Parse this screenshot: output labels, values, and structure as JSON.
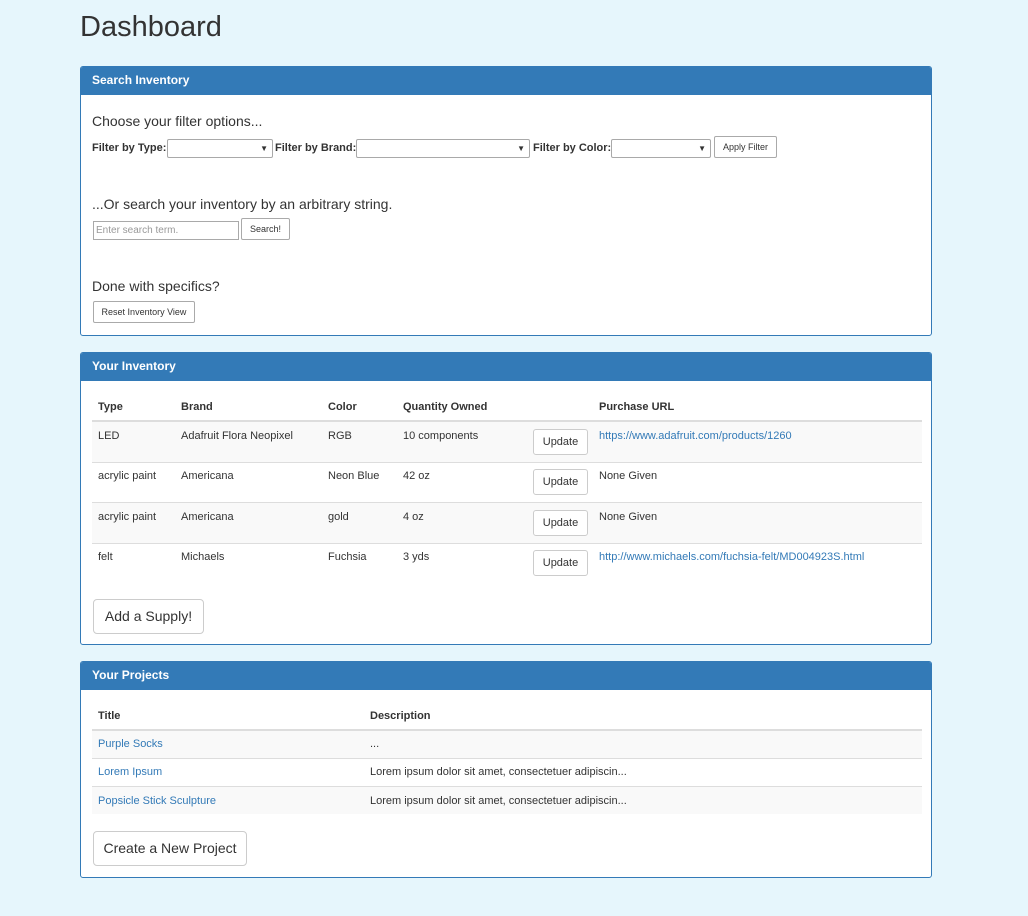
{
  "page_title": "Dashboard",
  "search_panel": {
    "heading": "Search Inventory",
    "filter_intro": "Choose your filter options...",
    "filter_type_label": "Filter by Type:",
    "filter_brand_label": "Filter by Brand:",
    "filter_color_label": "Filter by Color:",
    "filter_type_value": "",
    "filter_brand_value": "",
    "filter_color_value": "",
    "apply_filter_label": "Apply Filter",
    "search_intro": "...Or search your inventory by an arbitrary string.",
    "search_placeholder": "Enter search term.",
    "search_button_label": "Search!",
    "reset_intro": "Done with specifics?",
    "reset_button_label": "Reset Inventory View"
  },
  "inventory_panel": {
    "heading": "Your Inventory",
    "columns": [
      "Type",
      "Brand",
      "Color",
      "Quantity Owned",
      "Purchase URL"
    ],
    "update_label": "Update",
    "rows": [
      {
        "type": "LED",
        "brand": "Adafruit Flora Neopixel",
        "color": "RGB",
        "quantity": "10 components",
        "url": "https://www.adafruit.com/products/1260",
        "url_is_link": true
      },
      {
        "type": "acrylic paint",
        "brand": "Americana",
        "color": "Neon Blue",
        "quantity": "42 oz",
        "url": "None Given",
        "url_is_link": false
      },
      {
        "type": "acrylic paint",
        "brand": "Americana",
        "color": "gold",
        "quantity": "4 oz",
        "url": "None Given",
        "url_is_link": false
      },
      {
        "type": "felt",
        "brand": "Michaels",
        "color": "Fuchsia",
        "quantity": "3 yds",
        "url": "http://www.michaels.com/fuchsia-felt/MD004923S.html",
        "url_is_link": true
      }
    ],
    "add_button_label": "Add a Supply!"
  },
  "projects_panel": {
    "heading": "Your Projects",
    "columns": [
      "Title",
      "Description"
    ],
    "rows": [
      {
        "title": "Purple Socks",
        "description": "..."
      },
      {
        "title": "Lorem Ipsum",
        "description": "Lorem ipsum dolor sit amet, consectetuer adipiscin..."
      },
      {
        "title": "Popsicle Stick Sculpture",
        "description": "Lorem ipsum dolor sit amet, consectetuer adipiscin..."
      }
    ],
    "create_button_label": "Create a New Project"
  },
  "colors": {
    "page_background": "#e6f6fc",
    "panel_heading": "#337ab7",
    "link": "#337ab7",
    "row_stripe": "#f9f9f9"
  }
}
